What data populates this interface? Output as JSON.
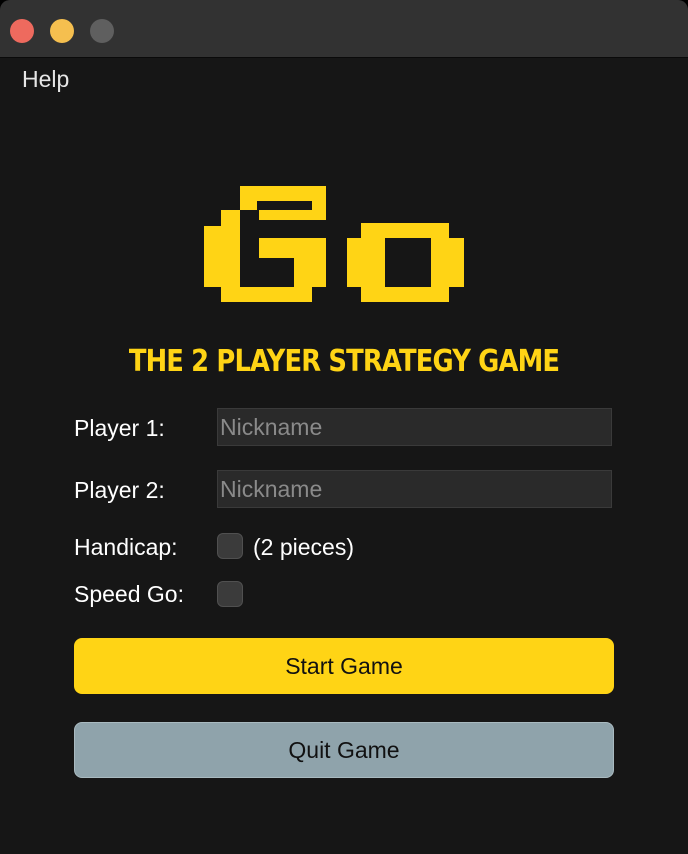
{
  "menu": {
    "help": "Help"
  },
  "logo": {
    "text": "Go",
    "color": "#ffd415"
  },
  "subtitle": "THE 2 PLAYER STRATEGY GAME",
  "form": {
    "player1_label": "Player 1:",
    "player1_placeholder": "Nickname",
    "player1_value": "",
    "player2_label": "Player 2:",
    "player2_placeholder": "Nickname",
    "player2_value": "",
    "handicap_label": "Handicap:",
    "handicap_note": "(2 pieces)",
    "handicap_checked": false,
    "speed_label": "Speed Go:",
    "speed_checked": false
  },
  "buttons": {
    "start": "Start Game",
    "quit": "Quit Game"
  },
  "colors": {
    "accent": "#ffd415",
    "background": "#161616",
    "quit_button": "#8fa3ab"
  }
}
